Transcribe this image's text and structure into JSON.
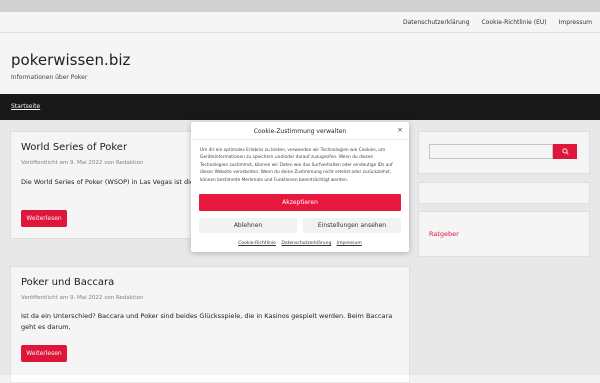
{
  "topnav": {
    "links": [
      "Datenschutzerklärung",
      "Cookie-Richtlinie (EU)",
      "Impressum"
    ]
  },
  "header": {
    "title": "pokerwissen.biz",
    "description": "Informationen über Poker"
  },
  "mainnav": {
    "home": "Startseite"
  },
  "posts": [
    {
      "title": "World Series of Poker",
      "meta": "Veröffentlicht am 9. Mai 2022 von Redaktion",
      "excerpt": "Die World Series of Poker (WSOP) in Las Vegas ist die ... Jedes Jahr im",
      "button": "Weiterlesen"
    },
    {
      "title": "Poker und Baccara",
      "meta": "Veröffentlicht am 9. Mai 2022 von Redaktion",
      "excerpt": "Ist da ein Unterschied? Baccara und Poker sind beides Glücksspiele, die in Kasinos gespielt werden. Beim Baccara geht es darum,",
      "button": "Weiterlesen"
    }
  ],
  "sidebar": {
    "search_icon": "search-icon",
    "ratgeber": "Ratgeber"
  },
  "cookie": {
    "title": "Cookie-Zustimmung verwalten",
    "text": "Um dir ein optimales Erlebnis zu bieten, verwenden wir Technologien wie Cookies, um Geräteinformationen zu speichern und/oder darauf zuzugreifen. Wenn du diesen Technologien zustimmst, können wir Daten wie das Surfverhalten oder eindeutige IDs auf dieser Website verarbeiten. Wenn du deine Zustimmung nicht erteilst oder zurückziehst, können bestimmte Merkmale und Funktionen beeinträchtigt werden.",
    "accept": "Akzeptieren",
    "deny": "Ablehnen",
    "settings": "Einstellungen ansehen",
    "links": [
      "Cookie-Richtlinie",
      "Datenschutzerklärung",
      "Impressum"
    ]
  },
  "colors": {
    "accent": "#e8173d",
    "nav_bg": "#1a1a1a"
  }
}
